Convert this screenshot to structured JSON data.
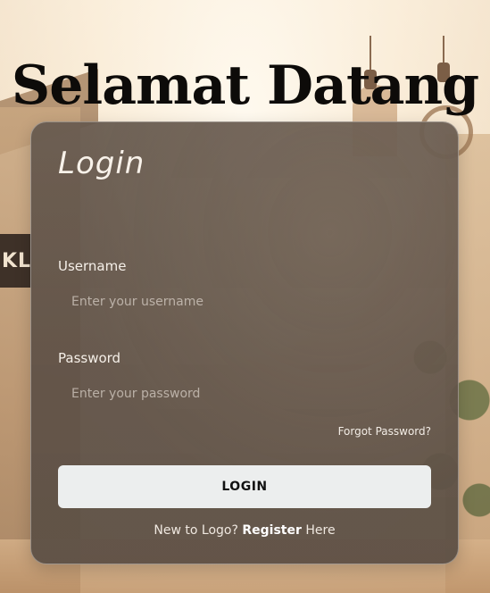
{
  "page": {
    "title": "Selamat Datang"
  },
  "background": {
    "sign_text": "KL"
  },
  "login_card": {
    "heading": "Login",
    "username": {
      "label": "Username",
      "placeholder": "Enter your username",
      "value": ""
    },
    "password": {
      "label": "Password",
      "placeholder": "Enter your password",
      "value": ""
    },
    "forgot_password": "Forgot Password?",
    "login_button": "LOGIN",
    "register": {
      "prefix": "New to Logo?",
      "link": "Register",
      "suffix": "Here"
    }
  },
  "colors": {
    "title": "#0d0b09",
    "card": "#6b5b4e",
    "button_bg": "#eceeee",
    "button_text": "#111111",
    "text_light": "#f5efe8"
  }
}
